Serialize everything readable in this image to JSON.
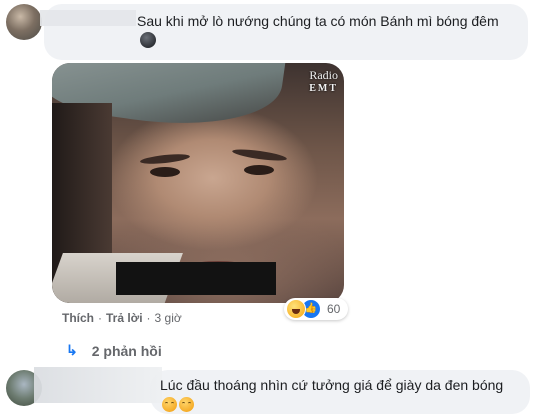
{
  "comment1": {
    "text": "Sau khi mở lò nướng chúng ta có món Bánh mì bóng đêm",
    "emoji": "dark-face-emoji",
    "image": {
      "watermark_top": "Radio",
      "watermark_bottom": "EMT"
    },
    "actions": {
      "like": "Thích",
      "reply": "Trả lời",
      "time": "3 giờ"
    },
    "reactions": {
      "icons": [
        "haha-icon",
        "like-icon"
      ],
      "count": "60"
    },
    "replies_label": "2 phản hồi"
  },
  "comment2": {
    "text": "Lúc đầu thoáng nhìn cứ tưởng giá để giày da đen bóng",
    "emojis": [
      "sad-face-emoji",
      "sad-face-emoji"
    ]
  },
  "colors": {
    "bubble": "#f0f2f5",
    "link": "#1877f2",
    "secondary_text": "#65676b"
  }
}
